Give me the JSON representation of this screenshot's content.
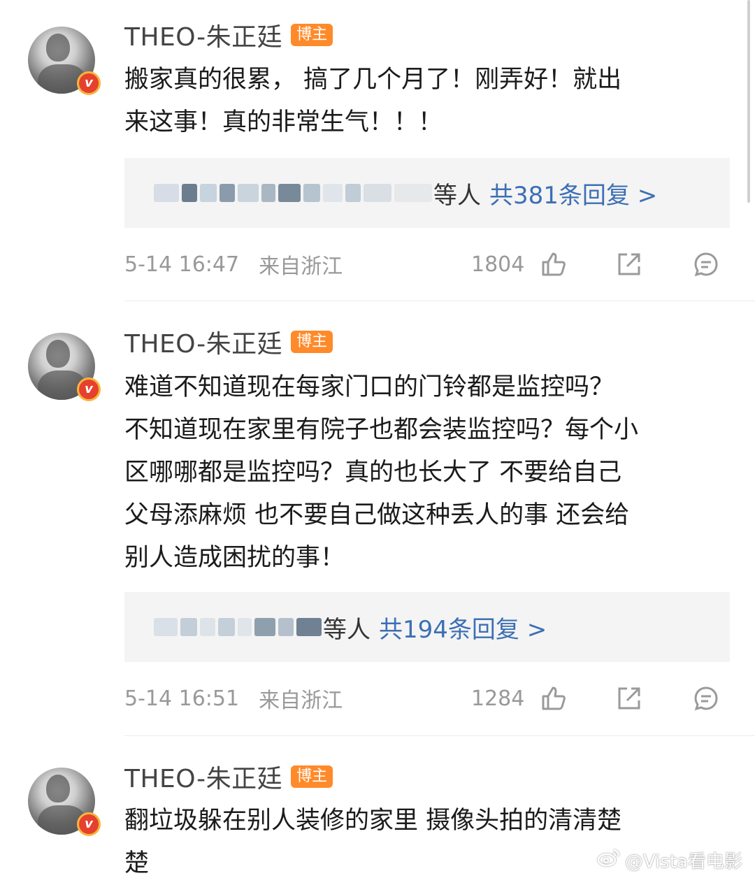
{
  "comments": [
    {
      "author": "THEO-朱正廷",
      "author_tag": "博主",
      "text_lines": [
        "搬家真的很累， 搞了几个月了！刚弄好！就出",
        "来这事！真的非常生气！！！"
      ],
      "replies_tail": "等人",
      "replies_label": "共381条回复 >",
      "time": "5-14 16:47",
      "location": "来自浙江",
      "likes": "1804"
    },
    {
      "author": "THEO-朱正廷",
      "author_tag": "博主",
      "text_lines": [
        "难道不知道现在每家门口的门铃都是监控吗？",
        "不知道现在家里有院子也都会装监控吗？每个小",
        "区哪哪都是监控吗？真的也长大了 不要给自己",
        "父母添麻烦 也不要自己做这种丢人的事 还会给",
        "别人造成困扰的事！"
      ],
      "replies_tail": "等人",
      "replies_label": "共194条回复 >",
      "time": "5-14 16:51",
      "location": "来自浙江",
      "likes": "1284"
    },
    {
      "author": "THEO-朱正廷",
      "author_tag": "博主",
      "text_lines": [
        "翻垃圾躲在别人装修的家里 摄像头拍的清清楚",
        "楚"
      ]
    }
  ],
  "verified_badge": "v",
  "watermark": "@Vista看电影",
  "icons": {
    "like": "thumbs-up-icon",
    "share": "share-icon",
    "comment": "comment-icon",
    "verified": "verified-badge-icon",
    "weibo": "weibo-logo-icon"
  },
  "colors": {
    "accent_link": "#3c6fb5",
    "tag_bg": "#ff8a2a",
    "verified": "#e5412d",
    "meta_text": "#999999"
  }
}
